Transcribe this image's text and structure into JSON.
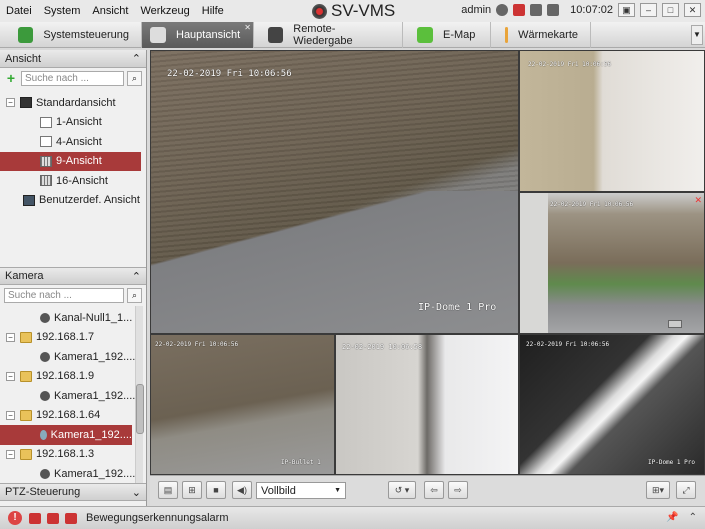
{
  "menu": [
    "Datei",
    "System",
    "Ansicht",
    "Werkzeug",
    "Hilfe"
  ],
  "app_title": "SV-VMS",
  "user": "admin",
  "clock": "10:07:02",
  "tabs": [
    {
      "label": "Systemsteuerung",
      "icon": "control-panel-icon",
      "color": "#3c9a3c"
    },
    {
      "label": "Hauptansicht",
      "icon": "main-view-icon",
      "color": "#dddddd"
    },
    {
      "label": "Remote-Wiedergabe",
      "icon": "playback-icon",
      "color": "#444444"
    },
    {
      "label": "E-Map",
      "icon": "emap-icon",
      "color": "#5bbf3c"
    },
    {
      "label": "Wärmekarte",
      "icon": "heatmap-icon",
      "color": "#e9a43a"
    }
  ],
  "view_panel": {
    "title": "Ansicht",
    "search_placeholder": "Suche nach ...",
    "items": [
      {
        "label": "Standardansicht",
        "icon": "monitor-icon",
        "expand": "−"
      },
      {
        "label": "1-Ansicht",
        "icon": "window-icon"
      },
      {
        "label": "4-Ansicht",
        "icon": "window-icon"
      },
      {
        "label": "9-Ansicht",
        "icon": "grid-icon"
      },
      {
        "label": "16-Ansicht",
        "icon": "grid-icon"
      },
      {
        "label": "Benutzerdef. Ansicht",
        "icon": "custom-view-icon"
      }
    ]
  },
  "camera_panel": {
    "title": "Kamera",
    "search_placeholder": "Suche nach ...",
    "items": [
      {
        "label": "Kanal-Null1_1...",
        "icon": "camera-icon"
      },
      {
        "label": "192.168.1.7",
        "icon": "folder-icon",
        "expand": "−"
      },
      {
        "label": "Kamera1_192....",
        "icon": "camera-icon"
      },
      {
        "label": "192.168.1.9",
        "icon": "folder-icon",
        "expand": "−"
      },
      {
        "label": "Kamera1_192....",
        "icon": "camera-icon"
      },
      {
        "label": "192.168.1.64",
        "icon": "folder-icon",
        "expand": "−"
      },
      {
        "label": "Kamera1_192....",
        "icon": "camera-icon"
      },
      {
        "label": "192.168.1.3",
        "icon": "folder-icon",
        "expand": "−"
      },
      {
        "label": "Kamera1_192....",
        "icon": "camera-icon"
      }
    ]
  },
  "ptz_panel": {
    "title": "PTZ-Steuerung"
  },
  "video": {
    "main_timestamp": "22-02-2019 Fri 10:06:56",
    "main_label": "IP-Dome 1 Pro",
    "small_timestamp": "22-02-2019 Fri 10:06:56",
    "center_timestamp": "22-02-2019 10:06:58",
    "tile_label": "IP-Bullet 1",
    "right_label": "IP-Dome 1 Pro"
  },
  "bottom": {
    "mode": "Vollbild"
  },
  "status": {
    "alarm_text": "Bewegungserkennungsalarm"
  }
}
